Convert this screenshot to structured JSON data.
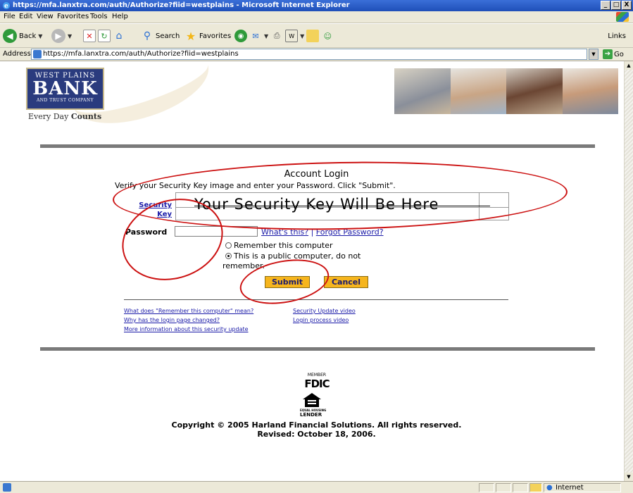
{
  "window": {
    "title": "https://mfa.lanxtra.com/auth/Authorize?fiid=westplains - Microsoft Internet Explorer",
    "min": "_",
    "max": "□",
    "close": "X"
  },
  "menu": [
    "File",
    "Edit",
    "View",
    "Favorites",
    "Tools",
    "Help"
  ],
  "toolbar": {
    "back": "Back",
    "search": "Search",
    "favorites": "Favorites",
    "links": "Links"
  },
  "address": {
    "label": "Address",
    "url": "https://mfa.lanxtra.com/auth/Authorize?fiid=westplains",
    "go": "Go"
  },
  "bank": {
    "line1": "WEST PLAINS",
    "line2": "BANK",
    "line3": "AND TRUST COMPANY",
    "tagline_prefix": "Every Day ",
    "tagline_bold": "Counts"
  },
  "login": {
    "title": "Account Login",
    "instructions": "Verify your Security Key image and enter your Password. Click \"Submit\".",
    "security_label_1": "Security",
    "security_label_2": "Key",
    "security_key_text": "Your Security Key Will Be Here",
    "password_label": "Password",
    "whats_this": "What's this?",
    "separator": "|",
    "forgot": "Forgot Password?",
    "remember": "Remember this computer",
    "public_1": "This is a public computer, do not",
    "public_2": "remember.",
    "submit": "Submit",
    "cancel": "Cancel"
  },
  "help_links": {
    "left": [
      "What does \"Remember this computer\" mean?",
      "Why has the login page changed?",
      "More information about this security update"
    ],
    "right": [
      "Security Update video",
      "Login process video"
    ]
  },
  "footer": {
    "member": "MEMBER",
    "fdic": "FDIC",
    "equal_housing": "EQUAL HOUSING",
    "lender": "LENDER",
    "copyright": "Copyright © 2005 Harland Financial Solutions.  All rights reserved.",
    "revised": "Revised: October 18, 2006."
  },
  "status": {
    "zone": "Internet"
  },
  "colors": {
    "annotation": "#cc1111",
    "button": "#f6b51d",
    "bank_blue": "#2a3b7e",
    "link": "#1a1aa8"
  }
}
